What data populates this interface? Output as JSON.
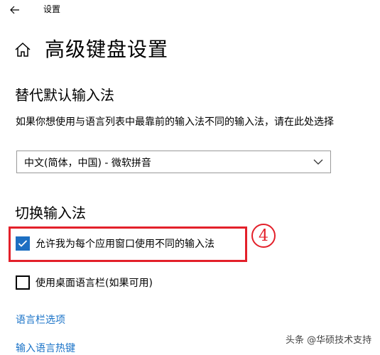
{
  "window": {
    "title": "设置"
  },
  "icons": {
    "back": "back-arrow-icon",
    "home": "home-icon",
    "dropdown": "chevron-down-icon",
    "check": "checkmark-icon"
  },
  "page": {
    "title": "高级键盘设置"
  },
  "override": {
    "heading": "替代默认输入法",
    "description": "如果你想使用与语言列表中最靠前的输入法不同的输入法，请在此处选择",
    "dropdown_value": "中文(简体，中国) - 微软拼音"
  },
  "switching": {
    "heading": "切换输入法",
    "per_app_label": "允许我为每个应用窗口使用不同的输入法",
    "per_app_checked": true,
    "language_bar_label": "使用桌面语言栏(如果可用)",
    "language_bar_checked": false
  },
  "annotation": {
    "step_number": "4"
  },
  "links": {
    "language_bar_options": "语言栏选项",
    "input_hotkeys": "输入语言热键"
  },
  "watermark": "头条 @华硕技术支持",
  "colors": {
    "accent": "#1d6fc2",
    "link": "#1a73c8",
    "annotation": "#e3202a"
  }
}
